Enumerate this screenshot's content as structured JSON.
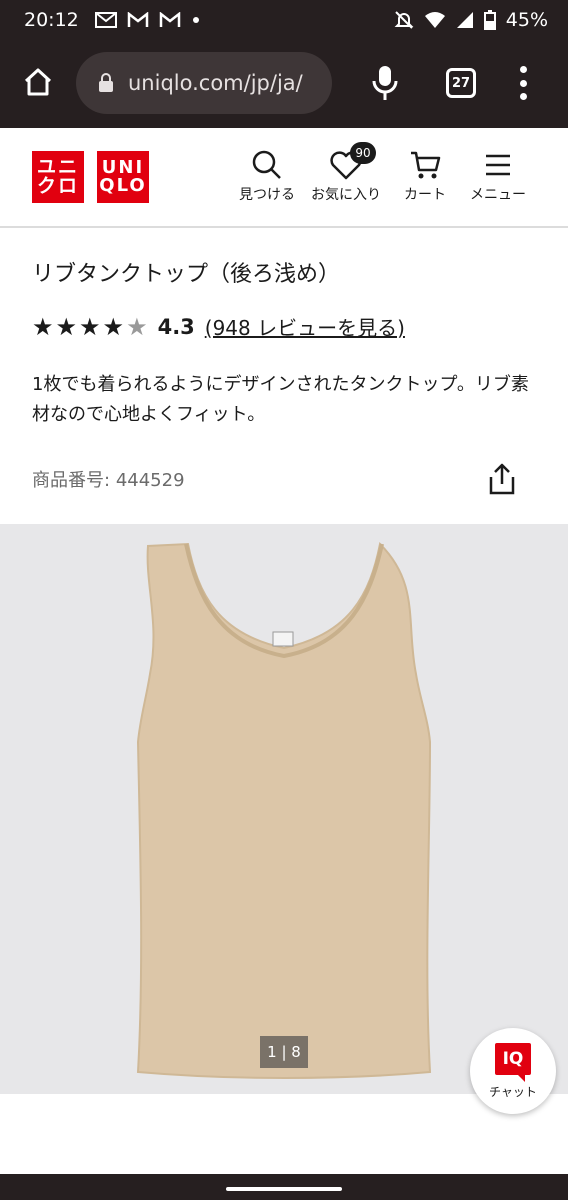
{
  "status_bar": {
    "time": "20:12",
    "battery": "45%",
    "icons": [
      "mail-icon",
      "gmail-icon",
      "gmail-icon",
      "dot-icon",
      "mute-icon",
      "wifi-icon",
      "signal-icon",
      "battery-icon"
    ]
  },
  "browser": {
    "url": "uniqlo.com/jp/ja/",
    "tab_count": "27"
  },
  "header": {
    "logo_ja": [
      "ユニ",
      "クロ"
    ],
    "logo_en": [
      "UNI",
      "QLO"
    ],
    "nav": {
      "search_label": "見つける",
      "favorites_label": "お気に入り",
      "favorites_count": "90",
      "cart_label": "カート",
      "menu_label": "メニュー"
    }
  },
  "product": {
    "title": "リブタンクトップ（後ろ浅め）",
    "stars": "★★★★",
    "half_star": "★",
    "rating": "4.3",
    "review_link": "(948 レビューを見る)",
    "description": "1枚でも着られるようにデザインされたタンクトップ。リブ素材なので心地よくフィット。",
    "sku_label": "商品番号:",
    "sku": "444529"
  },
  "gallery": {
    "counter": "1 | 8",
    "image_bg": "#e7e7e9",
    "garment_color": "#dcc6a8"
  },
  "chat": {
    "badge": "IQ",
    "label": "チャット"
  },
  "colors": {
    "brand_red": "#e1000f",
    "chrome_dark": "#261f20"
  }
}
